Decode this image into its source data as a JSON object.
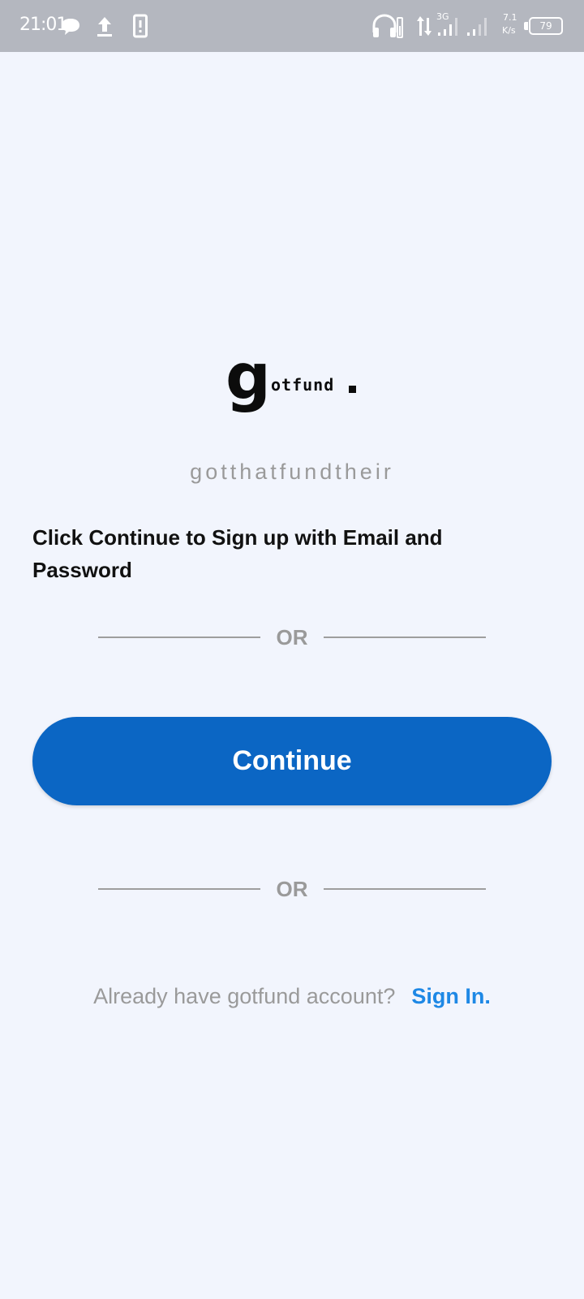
{
  "status_bar": {
    "time": "21:01",
    "network_type": "3G",
    "speed_value": "7.1",
    "speed_unit": "K/s",
    "battery_level": "79"
  },
  "logo": {
    "text": "gotfund"
  },
  "tagline": "gotthatfundtheir",
  "instruction": "Click Continue to Sign up with Email and Password",
  "divider_text": "OR",
  "continue_label": "Continue",
  "signin": {
    "prompt": "Already have gotfund account?",
    "link": "Sign In."
  },
  "colors": {
    "background": "#f2f5fd",
    "status_bar": "#b4b7bf",
    "primary_button": "#0b66c4",
    "link": "#1e88e5",
    "muted_text": "#9a9a9a"
  }
}
